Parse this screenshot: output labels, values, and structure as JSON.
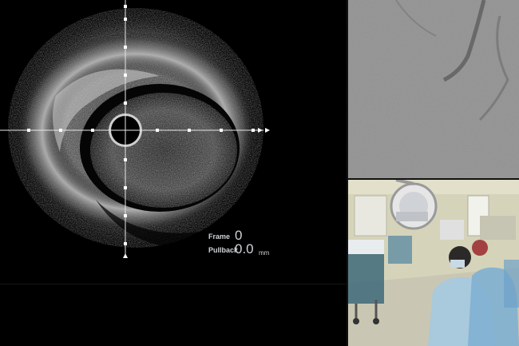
{
  "ivus": {
    "frame_label": "Frame",
    "frame_value": "0",
    "pullback_label": "Pullback",
    "pullback_value": "0.0",
    "pullback_unit": "mm"
  },
  "panels": {
    "main": "ivus-cross-section",
    "top_right": "angiography-view",
    "bottom_right": "cath-lab-camera"
  },
  "colors": {
    "background": "#000000",
    "readout_text": "#cfd3d8"
  }
}
